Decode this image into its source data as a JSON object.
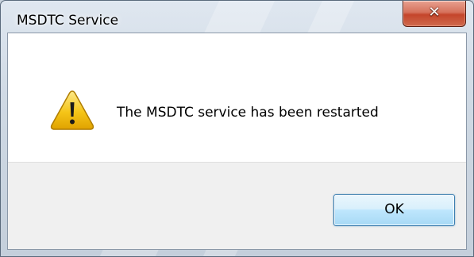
{
  "window": {
    "title": "MSDTC Service"
  },
  "titlebar": {
    "close_icon": "close-icon",
    "close_glyph": "✕"
  },
  "dialog": {
    "icon": "warning-icon",
    "message": "The MSDTC service has been restarted"
  },
  "buttons": {
    "ok_label": "OK"
  },
  "colors": {
    "close_button": "#c4452b",
    "ok_button_border": "#3c7fb1",
    "footer_background": "#f0f0f0",
    "warning_fill": "#f5c518"
  }
}
